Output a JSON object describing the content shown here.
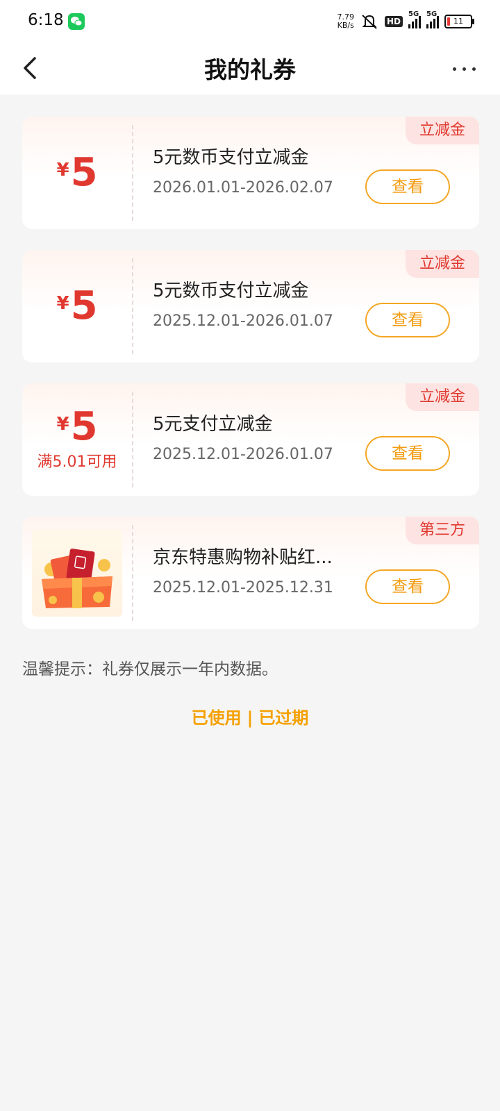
{
  "status_bar": {
    "time": "6:18",
    "speed": "7.79",
    "speed_unit": "KB/s",
    "hd": "HD",
    "net1": "5G",
    "net2": "5G",
    "battery": "11",
    "icons": [
      "wechat-icon",
      "mute-icon",
      "signal-icon",
      "battery-icon"
    ]
  },
  "header": {
    "title": "我的礼券"
  },
  "coupons": [
    {
      "tag": "立减金",
      "currency": "¥",
      "amount": "5",
      "condition": "",
      "name": "5元数币支付立减金",
      "date": "2026.01.01-2026.02.07",
      "button": "查看"
    },
    {
      "tag": "立减金",
      "currency": "¥",
      "amount": "5",
      "condition": "",
      "name": "5元数币支付立减金",
      "date": "2025.12.01-2026.01.07",
      "button": "查看"
    },
    {
      "tag": "立减金",
      "currency": "¥",
      "amount": "5",
      "condition": "满5.01可用",
      "name": "5元支付立减金",
      "date": "2025.12.01-2026.01.07",
      "button": "查看"
    },
    {
      "tag": "第三方",
      "name": "京东特惠购物补贴红...",
      "date": "2025.12.01-2025.12.31",
      "button": "查看"
    }
  ],
  "tip": "温馨提示：礼券仅展示一年内数据。",
  "history": {
    "used": "已使用",
    "separator": "|",
    "expired": "已过期"
  },
  "colors": {
    "accent_red": "#e0382f",
    "accent_orange": "#f5a000",
    "tag_bg": "#fde3e1",
    "page_bg": "#f5f5f5"
  }
}
